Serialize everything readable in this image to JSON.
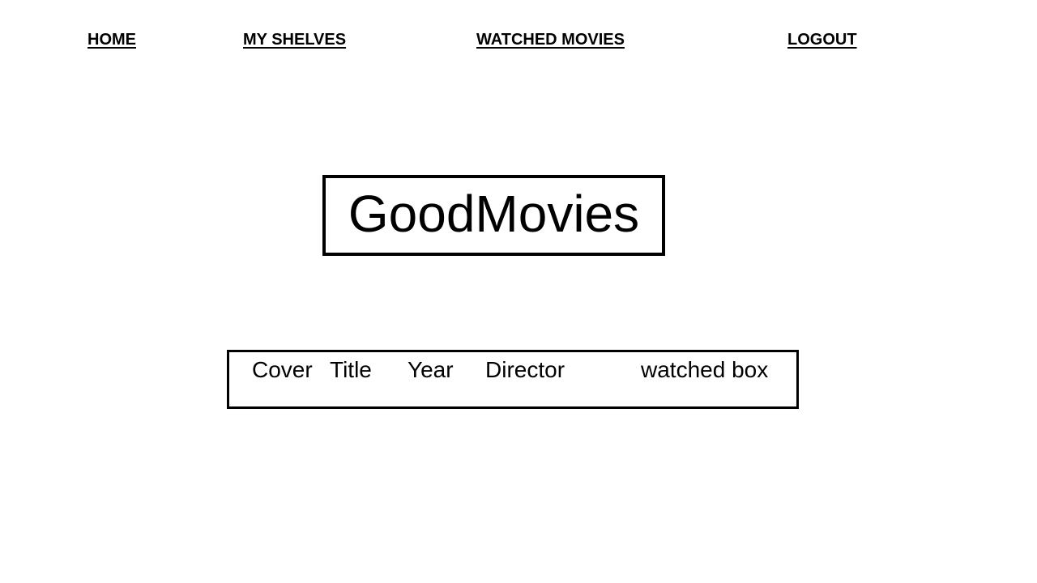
{
  "nav": {
    "home": "HOME",
    "my_shelves": "MY SHELVES",
    "watched_movies": "WATCHED MOVIES",
    "logout": "LOGOUT"
  },
  "logo": {
    "text": "GoodMovies"
  },
  "table": {
    "columns": [
      "Cover",
      "Title",
      "Year",
      "Director",
      "watched box"
    ]
  }
}
